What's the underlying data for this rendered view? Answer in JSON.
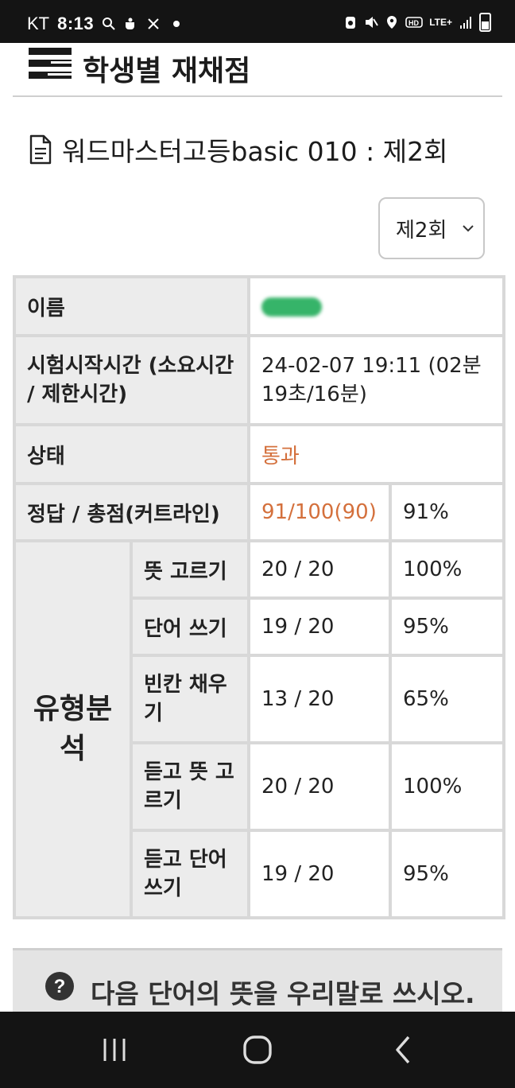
{
  "status_bar": {
    "carrier": "KT",
    "time": "8:13",
    "icons": [
      "search-icon",
      "coffee-icon",
      "tools-icon",
      "notification-dot"
    ],
    "right_icons": [
      "alarm-icon",
      "mute-icon",
      "location-icon",
      "hd-icon",
      "lte-signal-icon",
      "signal-icon",
      "battery-icon"
    ],
    "network": "LTE+"
  },
  "header": {
    "title": "학생별 재채점"
  },
  "test": {
    "title": "워드마스터고등basic 010 : 제2회"
  },
  "round_select": {
    "value": "제2회"
  },
  "table": {
    "name_label": "이름",
    "name_value": "",
    "start_label": "시험시작시간 (소요시간 / 제한시간)",
    "start_value": "24-02-07 19:11 (02분 19초/16분)",
    "status_label": "상태",
    "status_value": "통과",
    "score_label": "정답 / 총점(커트라인)",
    "score_value": "91/100(90)",
    "score_pct": "91%",
    "analysis_label": "유형분석",
    "types": [
      {
        "label": "뜻 고르기",
        "score": "20 / 20",
        "pct": "100%"
      },
      {
        "label": "단어 쓰기",
        "score": "19 / 20",
        "pct": "95%"
      },
      {
        "label": "빈칸 채우기",
        "score": "13 / 20",
        "pct": "65%"
      },
      {
        "label": "듣고 뜻 고르기",
        "score": "20 / 20",
        "pct": "100%"
      },
      {
        "label": "듣고 단어 쓰기",
        "score": "19 / 20",
        "pct": "95%"
      }
    ]
  },
  "banner": {
    "text": "다음 단어의 뜻을 우리말로 쓰시오."
  },
  "colors": {
    "accent_orange": "#d4703c",
    "label_bg": "#ececec",
    "border": "#d8d8d8"
  }
}
